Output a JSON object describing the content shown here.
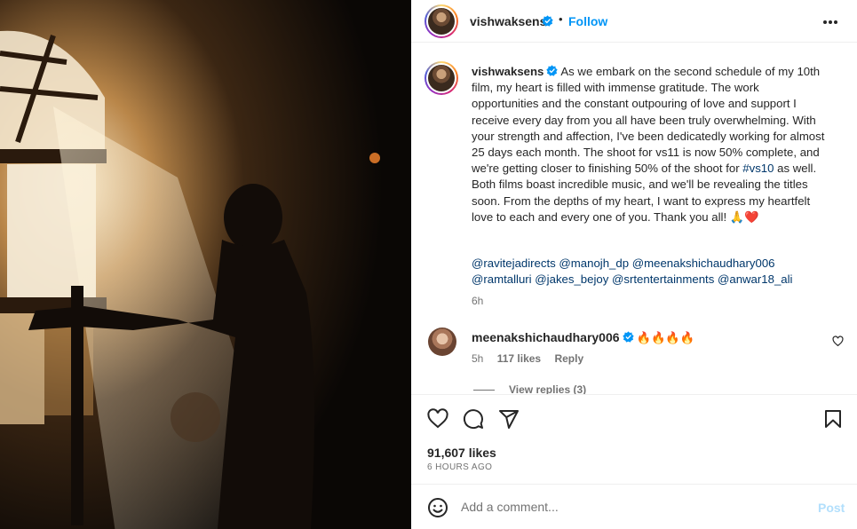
{
  "post": {
    "author": "vishwaksens",
    "header": {
      "dot": "•",
      "follow_label": "Follow"
    },
    "caption": {
      "text_part1": "As we embark on the second schedule of my 10th film, my heart is filled with immense gratitude. The work opportunities and the constant outpouring of love and support I receive every day from you all have been truly overwhelming. With your strength and affection, I've been dedicatedly working for almost 25 days each month. The shoot for vs11 is now 50% complete, and we're getting closer to finishing 50% of the shoot for ",
      "hashtag": "#vs10",
      "text_part2": " as well. Both films boast incredible music, and we'll be revealing the titles soon. From the depths of my heart, I want to express my heartfelt love to each and every one of you. Thank you all! 🙏❤️",
      "mentions": [
        "@ravitejadirects",
        "@manojh_dp",
        "@meenakshichaudhary006",
        "@ramtalluri",
        "@jakes_bejoy",
        "@srtentertainments",
        "@anwar18_ali"
      ],
      "time": "6h"
    },
    "comment": {
      "author": "meenakshichaudhary006",
      "text": "🔥🔥🔥🔥",
      "time": "5h",
      "likes": "117 likes",
      "reply_label": "Reply",
      "view_replies": "View replies (3)"
    },
    "likes_count": "91,607 likes",
    "time_ago": "6 HOURS AGO",
    "add_comment": {
      "placeholder": "Add a comment...",
      "post_label": "Post"
    }
  },
  "icons": {
    "header_more": "more-horizontal-icon",
    "verified": "verified-badge-icon",
    "like": "heart-icon",
    "comment": "comment-icon",
    "share": "share-icon",
    "save": "bookmark-icon",
    "emoji": "emoji-icon"
  },
  "colors": {
    "link": "#0095f6",
    "mention": "#00376b",
    "post_disabled": "#b2dffc"
  }
}
